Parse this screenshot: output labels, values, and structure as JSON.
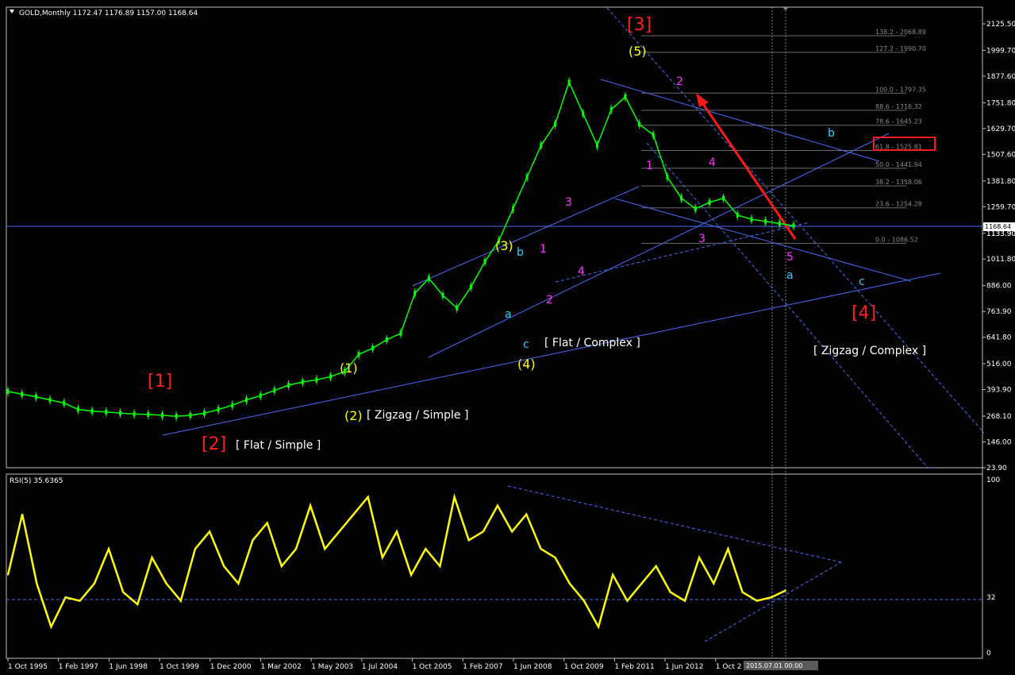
{
  "symbol_info": "GOLD,Monthly  1172.47 1176.89 1157.00 1168.64",
  "rsi_info": "RSI(5) 35.6365",
  "current_price_label": "1168.64",
  "last_price_tag": "1133.90",
  "date_tag": "2015.07.01 00:00",
  "colors": {
    "background": "#000000",
    "candles": "#00ff00",
    "rsi": "#ffff00",
    "trendlines": "#4a6cf0",
    "arrow": "#ff1a1a",
    "wave_red": "#ff2020",
    "wave_yellow": "#ffff00",
    "wave_magenta": "#ff33ff",
    "wave_cyan": "#33ccff"
  },
  "price_axis": {
    "ticks": [
      "2125.50",
      "1999.70",
      "1877.60",
      "1751.80",
      "1629.70",
      "1507.60",
      "1381.80",
      "1259.70",
      "1133.90",
      "1011.80",
      "886.00",
      "763.90",
      "641.80",
      "516.00",
      "393.90",
      "268.10",
      "146.00",
      "23.90"
    ],
    "range": [
      23.9,
      2170
    ]
  },
  "rsi_axis": {
    "ticks": [
      "100",
      "32",
      "0"
    ]
  },
  "time_axis": {
    "ticks": [
      "1 Oct 1995",
      "1 Feb 1997",
      "1 Jun 1998",
      "1 Oct 1999",
      "1 Dec 2000",
      "1 Mar 2002",
      "1 May 2003",
      "1 Jul 2004",
      "1 Oct 2005",
      "1 Feb 2007",
      "1 Jun 2008",
      "1 Oct 2009",
      "1 Feb 2011",
      "1 Jun 2012",
      "1 Oct 2"
    ]
  },
  "fib_levels": [
    {
      "label": "138.2 - 2068.89",
      "price": 2068.89
    },
    {
      "label": "127.2 - 1990.70",
      "price": 1990.7
    },
    {
      "label": "100.0 - 1797.35",
      "price": 1797.35
    },
    {
      "label": "88.6 - 1716.32",
      "price": 1716.32
    },
    {
      "label": "78.6 - 1645.23",
      "price": 1645.23
    },
    {
      "label": "61.8 - 1525.81",
      "price": 1525.81,
      "highlight": true
    },
    {
      "label": "50.0 - 1441.94",
      "price": 1441.94
    },
    {
      "label": "38.2 - 1358.06",
      "price": 1358.06
    },
    {
      "label": "23.6 - 1254.28",
      "price": 1254.28
    },
    {
      "label": "0.0 - 1086.52",
      "price": 1086.52
    }
  ],
  "wave_labels": [
    {
      "text": "[1]",
      "color": "red",
      "size": "big"
    },
    {
      "text": "[2]",
      "color": "red",
      "size": "big"
    },
    {
      "text": "[3]",
      "color": "red",
      "size": "big"
    },
    {
      "text": "[4]",
      "color": "red",
      "size": "big"
    },
    {
      "text": "(1)",
      "color": "yellow"
    },
    {
      "text": "(2)",
      "color": "yellow"
    },
    {
      "text": "(3)",
      "color": "yellow"
    },
    {
      "text": "(4)",
      "color": "yellow"
    },
    {
      "text": "(5)",
      "color": "yellow"
    },
    {
      "text": "1",
      "color": "magenta"
    },
    {
      "text": "2",
      "color": "magenta"
    },
    {
      "text": "3",
      "color": "magenta"
    },
    {
      "text": "4",
      "color": "magenta"
    },
    {
      "text": "1",
      "color": "magenta"
    },
    {
      "text": "2",
      "color": "magenta"
    },
    {
      "text": "3",
      "color": "magenta"
    },
    {
      "text": "4",
      "color": "magenta"
    },
    {
      "text": "5",
      "color": "magenta"
    },
    {
      "text": "a",
      "color": "cyan"
    },
    {
      "text": "b",
      "color": "cyan"
    },
    {
      "text": "c",
      "color": "cyan"
    },
    {
      "text": "a",
      "color": "cyan"
    },
    {
      "text": "b",
      "color": "cyan"
    },
    {
      "text": "c",
      "color": "cyan"
    }
  ],
  "annotations": [
    "[ Flat / Simple ]",
    "[ Zigzag / Simple ]",
    "[ Flat / Complex ]",
    "[ Zigzag / Complex ]"
  ],
  "chart_data": [
    {
      "type": "line",
      "title": "GOLD,Monthly",
      "series": [
        {
          "name": "GOLD,Monthly",
          "values": [
            385,
            372,
            360,
            345,
            330,
            300,
            292,
            288,
            283,
            278,
            276,
            272,
            268,
            272,
            282,
            300,
            320,
            345,
            365,
            390,
            415,
            430,
            440,
            455,
            480,
            560,
            590,
            630,
            660,
            850,
            920,
            840,
            780,
            880,
            1000,
            1100,
            1250,
            1400,
            1550,
            1650,
            1850,
            1700,
            1550,
            1720,
            1780,
            1650,
            1600,
            1400,
            1300,
            1250,
            1280,
            1300,
            1220,
            1200,
            1190,
            1180,
            1170
          ]
        }
      ],
      "x": [
        "1995",
        "1996",
        "1997",
        "1997",
        "1998",
        "1999",
        "1999",
        "2000",
        "2000",
        "2001",
        "2001",
        "2002",
        "2002",
        "2002",
        "2003",
        "2003",
        "2003",
        "2004",
        "2004",
        "2004",
        "2005",
        "2005",
        "2005",
        "2006",
        "2006",
        "2006",
        "2007",
        "2007",
        "2007",
        "2008",
        "2008",
        "2008",
        "2009",
        "2009",
        "2009",
        "2010",
        "2010",
        "2010",
        "2011",
        "2011",
        "2011",
        "2011",
        "2012",
        "2012",
        "2012",
        "2013",
        "2013",
        "2013",
        "2013",
        "2014",
        "2014",
        "2014",
        "2014",
        "2015",
        "2015",
        "2015",
        "2015"
      ],
      "ylim": [
        23.9,
        2170
      ]
    },
    {
      "type": "line",
      "title": "RSI(5) 35.6365",
      "series": [
        {
          "name": "RSI(5)",
          "values": [
            45,
            80,
            40,
            15,
            32,
            30,
            40,
            60,
            35,
            28,
            55,
            40,
            30,
            60,
            70,
            50,
            40,
            65,
            75,
            50,
            60,
            85,
            60,
            70,
            80,
            90,
            55,
            70,
            45,
            60,
            50,
            90,
            65,
            70,
            85,
            70,
            80,
            60,
            55,
            40,
            30,
            15,
            45,
            30,
            40,
            50,
            35,
            30,
            55,
            40,
            60,
            35,
            30,
            32,
            36
          ]
        }
      ],
      "ylim": [
        0,
        100
      ],
      "levels": [
        32
      ]
    }
  ]
}
